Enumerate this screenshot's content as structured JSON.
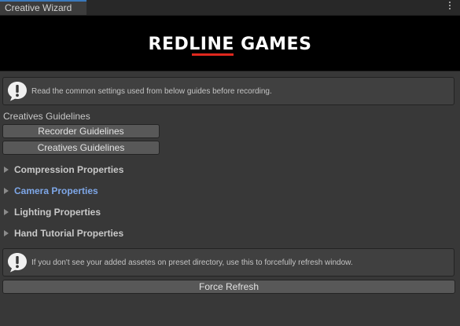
{
  "window": {
    "tab_title": "Creative Wizard",
    "menu_icon": "kebab-menu-icon"
  },
  "banner": {
    "logo_text": "REDLINE GAMES",
    "background": "#000000",
    "accent": "#e0281e"
  },
  "help_top": {
    "icon": "warning-icon",
    "text": "Read the common settings used from below guides before recording."
  },
  "guidelines": {
    "label": "Creatives Guidelines",
    "buttons": [
      "Recorder Guidelines",
      "Creatives Guidelines"
    ]
  },
  "foldouts": [
    {
      "label": "Compression Properties",
      "active": false
    },
    {
      "label": "Camera Properties",
      "active": true
    },
    {
      "label": "Lighting Properties",
      "active": false
    },
    {
      "label": "Hand Tutorial Properties",
      "active": false
    }
  ],
  "help_bottom": {
    "icon": "warning-icon",
    "text": "If you don't see your added assetes on preset directory, use this to forcefully refresh window."
  },
  "force_refresh_label": "Force Refresh",
  "colors": {
    "panel": "#383838",
    "tab_accent": "#3a79bb",
    "active_foldout": "#7ea7e8"
  }
}
